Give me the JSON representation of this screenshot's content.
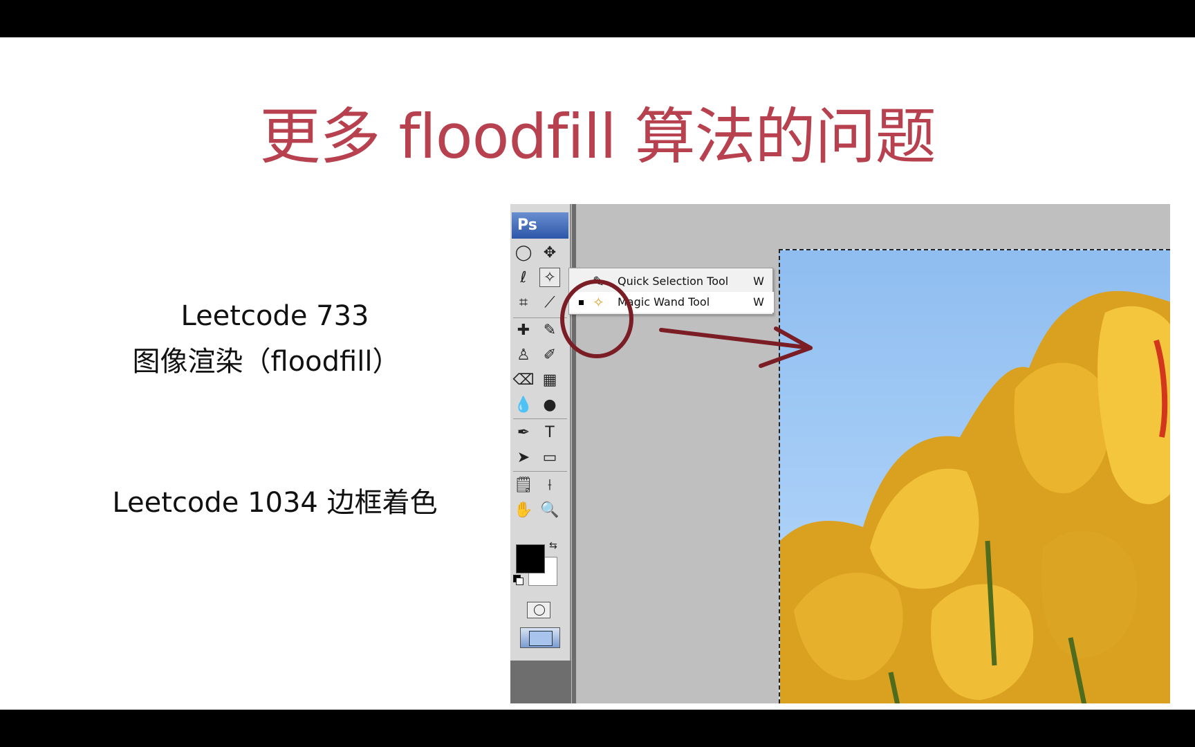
{
  "slide": {
    "title": "更多 floodfill 算法的问题",
    "problem1_line1": "Leetcode 733",
    "problem1_line2": "图像渲染（floodfill）",
    "problem2": "Leetcode 1034 边框着色"
  },
  "photoshop": {
    "logo": "Ps",
    "flyout": [
      {
        "label": "Quick Selection Tool",
        "shortcut": "W",
        "selected": false
      },
      {
        "label": "Magic Wand Tool",
        "shortcut": "W",
        "selected": true
      }
    ],
    "tools": [
      {
        "name": "marquee-tool",
        "glyph": "◯"
      },
      {
        "name": "move-tool",
        "glyph": "✥"
      },
      {
        "name": "lasso-tool",
        "glyph": "ℓ"
      },
      {
        "name": "magic-wand-tool",
        "glyph": "✧"
      },
      {
        "name": "crop-tool",
        "glyph": "⌗"
      },
      {
        "name": "slice-tool",
        "glyph": "⟋"
      },
      {
        "name": "healing-brush-tool",
        "glyph": "✚"
      },
      {
        "name": "brush-tool",
        "glyph": "✎"
      },
      {
        "name": "clone-stamp-tool",
        "glyph": "♙"
      },
      {
        "name": "history-brush-tool",
        "glyph": "✐"
      },
      {
        "name": "eraser-tool",
        "glyph": "⌫"
      },
      {
        "name": "gradient-tool",
        "glyph": "▦"
      },
      {
        "name": "blur-tool",
        "glyph": "💧"
      },
      {
        "name": "dodge-tool",
        "glyph": "●"
      },
      {
        "name": "pen-tool",
        "glyph": "✒"
      },
      {
        "name": "type-tool",
        "glyph": "T"
      },
      {
        "name": "path-selection-tool",
        "glyph": "➤"
      },
      {
        "name": "shape-tool",
        "glyph": "▭"
      },
      {
        "name": "notes-tool",
        "glyph": "🗒"
      },
      {
        "name": "eyedropper-tool",
        "glyph": "⟊"
      },
      {
        "name": "hand-tool",
        "glyph": "✋"
      },
      {
        "name": "zoom-tool",
        "glyph": "🔍"
      }
    ],
    "swap_glyph": "⇆",
    "colors": {
      "foreground": "#000000",
      "background": "#ffffff",
      "annotation": "#7a1d24",
      "title": "#b8414f"
    }
  }
}
